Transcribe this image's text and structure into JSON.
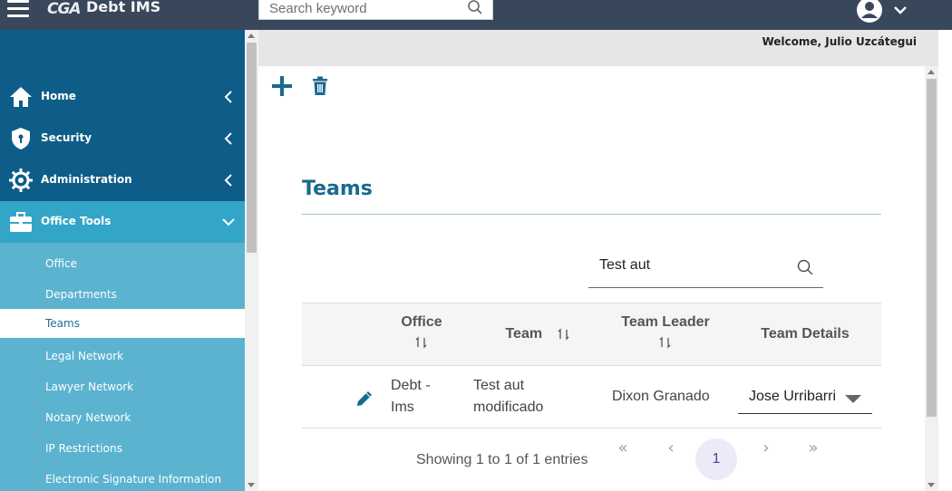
{
  "topbar": {
    "logo_text": "CGA",
    "app_title": "Debt IMS",
    "search_placeholder": "Search keyword"
  },
  "sidebar": {
    "items": [
      {
        "label": "Home",
        "icon": "home-icon"
      },
      {
        "label": "Security",
        "icon": "shield-icon"
      },
      {
        "label": "Administration",
        "icon": "gear-icon"
      },
      {
        "label": "Office Tools",
        "icon": "briefcase-icon",
        "expanded": true
      }
    ],
    "subitems": [
      {
        "label": "Office"
      },
      {
        "label": "Departments"
      },
      {
        "label": "Teams",
        "active": true
      },
      {
        "label": "Legal Network"
      },
      {
        "label": "Lawyer Network"
      },
      {
        "label": "Notary Network"
      },
      {
        "label": "IP Restrictions"
      },
      {
        "label": "Electronic Signature Information"
      }
    ]
  },
  "header": {
    "welcome": "Welcome, Julio Uzcátegui"
  },
  "page": {
    "title": "Teams",
    "filter_value": "Test aut"
  },
  "table": {
    "columns": [
      "Office",
      "Team",
      "Team Leader",
      "Team Details"
    ],
    "rows": [
      {
        "office": [
          "Debt -",
          "Ims"
        ],
        "team": [
          "Test aut",
          "modificado"
        ],
        "team_leader": "Dixon Granado",
        "team_details": "Jose Urribarri"
      }
    ]
  },
  "pagination": {
    "info": "Showing 1 to 1 of 1 entries",
    "first": "«",
    "prev": "‹",
    "current": "1",
    "next": "›",
    "last": "»"
  },
  "colors": {
    "topbar": "#39475a",
    "sidebar": "#0d5d88",
    "sidebar_active_group": "#33a5c7",
    "sidebar_sub": "#5bb3d0",
    "accent": "#186a8f"
  }
}
